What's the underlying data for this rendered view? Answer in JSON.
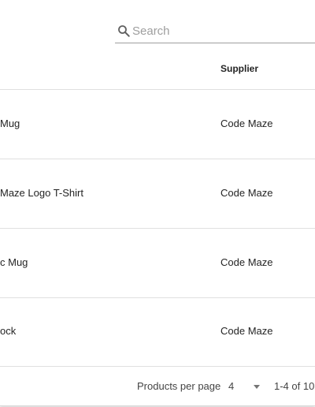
{
  "search": {
    "placeholder": "Search",
    "value": ""
  },
  "table": {
    "columns": [
      "Supplier"
    ],
    "rows": [
      {
        "name": "Mug",
        "supplier": "Code Maze"
      },
      {
        "name": "Maze Logo T-Shirt",
        "supplier": "Code Maze"
      },
      {
        "name": "c Mug",
        "supplier": "Code Maze"
      },
      {
        "name": "ock",
        "supplier": "Code Maze"
      }
    ]
  },
  "pagination": {
    "per_page_label": "Products per page",
    "per_page_value": "4",
    "range": "1-4 of 10"
  },
  "icons": {
    "search": "search-icon",
    "dropdown": "caret-down-icon"
  }
}
